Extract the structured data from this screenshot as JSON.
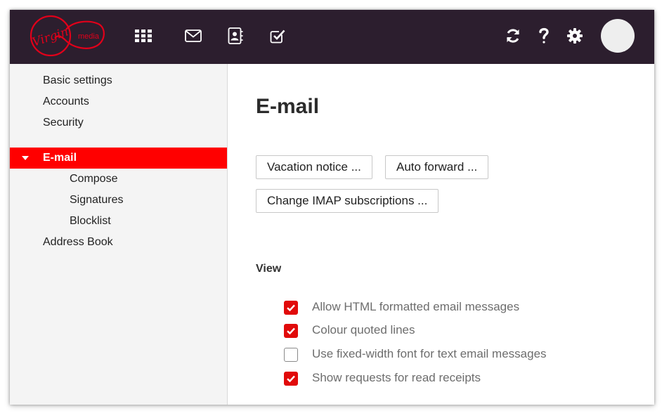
{
  "brand": {
    "logo_word": "Virgin",
    "logo_sub": "media",
    "logo_color": "#e1001a",
    "header_bg": "#2c1e2e",
    "accent": "#ff0000"
  },
  "header": {
    "nav_icons": [
      "apps-grid-icon",
      "mail-icon",
      "contacts-icon",
      "tasks-icon"
    ],
    "action_icons": [
      "refresh-icon",
      "help-icon",
      "settings-gear-icon"
    ],
    "avatar": "avatar"
  },
  "sidebar": {
    "items": [
      {
        "label": "Basic settings",
        "level": 0
      },
      {
        "label": "Accounts",
        "level": 0
      },
      {
        "label": "Security",
        "level": 0
      },
      {
        "label": "E-mail",
        "level": 0,
        "active": true
      },
      {
        "label": "Compose",
        "level": 1
      },
      {
        "label": "Signatures",
        "level": 1
      },
      {
        "label": "Blocklist",
        "level": 1
      },
      {
        "label": "Address Book",
        "level": 0
      }
    ]
  },
  "main": {
    "title": "E-mail",
    "buttons": {
      "vacation": "Vacation notice ...",
      "forward": "Auto forward ...",
      "imap": "Change IMAP subscriptions ..."
    },
    "view_section": {
      "title": "View",
      "options": [
        {
          "label": "Allow HTML formatted email messages",
          "checked": true
        },
        {
          "label": "Colour quoted lines",
          "checked": true
        },
        {
          "label": "Use fixed-width font for text email messages",
          "checked": false
        },
        {
          "label": "Show requests for read receipts",
          "checked": true
        }
      ]
    }
  }
}
